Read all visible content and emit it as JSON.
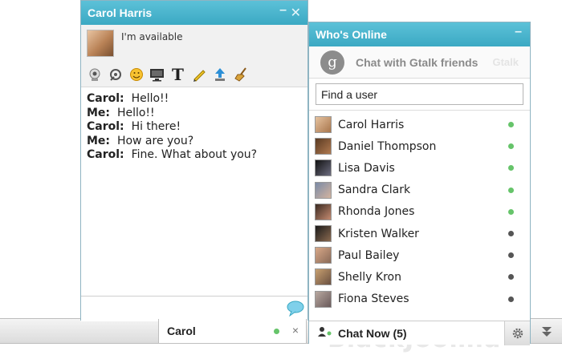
{
  "chat_window": {
    "title": "Carol Harris",
    "status_message": "I'm available",
    "toolbar_icons": [
      "webcam-icon",
      "audio-icon",
      "smiley-icon",
      "screen-share-icon",
      "text-format-icon",
      "pencil-icon",
      "upload-icon",
      "broom-icon"
    ],
    "messages": [
      {
        "sender": "Carol:",
        "text": "Hello!!"
      },
      {
        "sender": "Me:",
        "text": "Hello!!"
      },
      {
        "sender": "Carol:",
        "text": "Hi there!"
      },
      {
        "sender": "Me:",
        "text": "How are you?"
      },
      {
        "sender": "Carol:",
        "text": "Fine. What about you?"
      }
    ]
  },
  "chat_tab": {
    "label": "Carol",
    "close": "×"
  },
  "online_window": {
    "title": "Who's Online",
    "gtalk_label": "Chat with Gtalk friends",
    "gtalk_ghost": "Gtalk",
    "search_placeholder": "Find a user",
    "users": [
      {
        "name": "Carol Harris",
        "online": true
      },
      {
        "name": "Daniel Thompson",
        "online": true
      },
      {
        "name": "Lisa Davis",
        "online": true
      },
      {
        "name": "Sandra Clark",
        "online": true
      },
      {
        "name": "Rhonda Jones",
        "online": true
      },
      {
        "name": "Kristen Walker",
        "online": false
      },
      {
        "name": "Paul Bailey",
        "online": false
      },
      {
        "name": "Shelly Kron",
        "online": false
      },
      {
        "name": "Fiona Steves",
        "online": false
      }
    ],
    "chat_now_label": "Chat Now (5)"
  },
  "watermark": "BlackJoomla",
  "colors": {
    "header": "#3ba9c3",
    "online_dot": "#66c46a",
    "offline_dot": "#555555"
  }
}
